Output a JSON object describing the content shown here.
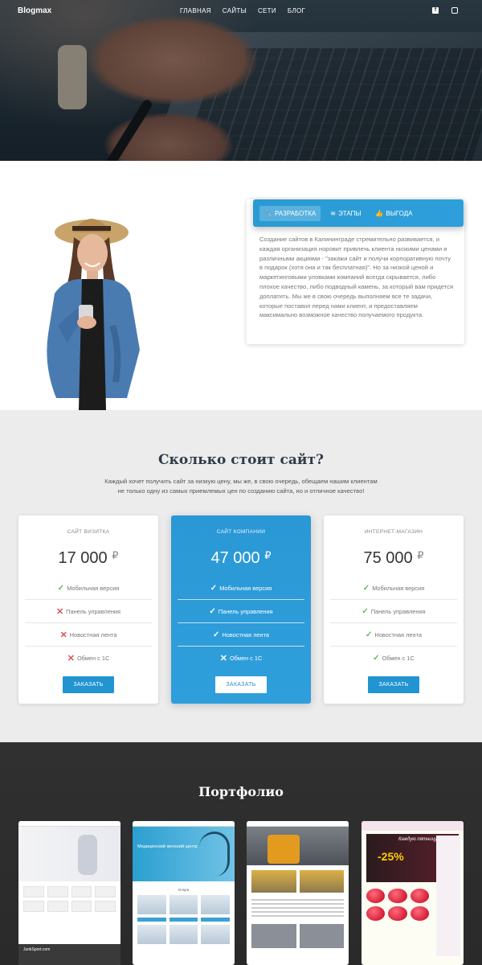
{
  "header": {
    "brand": "Blogmax",
    "menu": [
      "ГЛАВНАЯ",
      "САЙТЫ",
      "СЕТИ",
      "БЛОГ"
    ],
    "social": [
      "f",
      "◎"
    ]
  },
  "about": {
    "tabs": [
      {
        "icon": "wrench-icon",
        "label": "РАЗРАБОТКА"
      },
      {
        "icon": "layers-icon",
        "label": "ЭТАПЫ"
      },
      {
        "icon": "thumbs-up-icon",
        "label": "ВЫГОДА"
      }
    ],
    "text": "Создание сайтов в Калининграде стремительно развивается, и каждая организация норовит привлечь клиента низкими ценами и различными акциями - \"закажи сайт и получи корпоративную почту в подарок (хотя она и так бесплатная)\". Но за низкой ценой и маркетинговыми уловками компаний всегда скрывается, либо плохое качество, либо подводный камень, за который вам придется доплатить. Мы же в свою очередь выполняем все те задачи, которые поставил перед нами клиент, и предоставляем максимально возможное качество получаемого продукта."
  },
  "pricing": {
    "title": "Сколько стоит сайт?",
    "subtitle_line1": "Каждый хочет получить сайт за низкую цену, мы же, в свою очередь, обещаем нашим клиентам",
    "subtitle_line2": "не только одну из самых приемлемых цен по созданию сайта, но и отличное качество!",
    "currency": "₽",
    "order_label": "ЗАКАЗАТЬ",
    "plans": [
      {
        "name": "САЙТ ВИЗИТКА",
        "price": "17 000",
        "features": [
          {
            "label": "Мобильная версия",
            "included": true
          },
          {
            "label": "Панель управления",
            "included": false
          },
          {
            "label": "Новостная лента",
            "included": false
          },
          {
            "label": "Обмен с 1С",
            "included": false
          }
        ]
      },
      {
        "name": "САЙТ КОМПАНИИ",
        "price": "47 000",
        "features": [
          {
            "label": "Мобильная версия",
            "included": true
          },
          {
            "label": "Панель управления",
            "included": true
          },
          {
            "label": "Новостная лента",
            "included": true
          },
          {
            "label": "Обмен с 1С",
            "included": false
          }
        ]
      },
      {
        "name": "ИНТЕРНЕТ-МАГАЗИН",
        "price": "75 000",
        "features": [
          {
            "label": "Мобильная версия",
            "included": true
          },
          {
            "label": "Панель управления",
            "included": true
          },
          {
            "label": "Новостная лента",
            "included": true
          },
          {
            "label": "Обмен с 1С",
            "included": true
          }
        ]
      }
    ]
  },
  "portfolio": {
    "title": "Портфолио",
    "thumb1_caption": "JunkSport.com",
    "thumb2_caption": "Медицинский женский центр",
    "thumb2_section": "Услуги",
    "thumb4_promo": "-25%",
    "thumb4_promo_text": "Каждую пятницу"
  },
  "colors": {
    "accent": "#2a98d5",
    "check": "#5cb85c",
    "cross": "#d9534f",
    "pricing_bg": "#ececec",
    "portfolio_bg": "#2f2f2f"
  }
}
